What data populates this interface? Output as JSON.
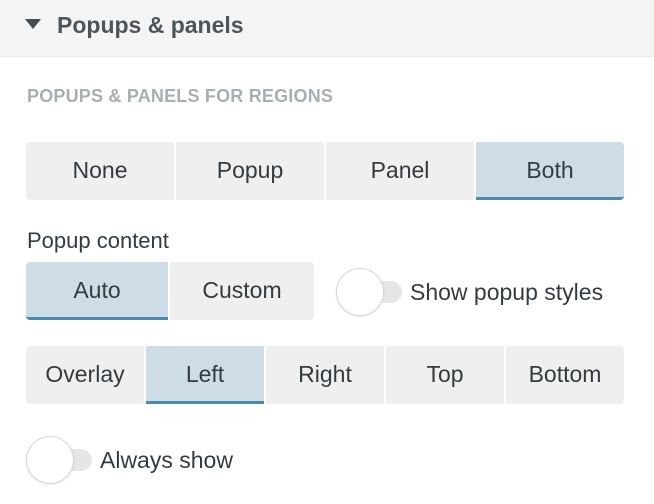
{
  "section": {
    "title": "Popups & panels",
    "expanded": true
  },
  "regions": {
    "heading": "POPUPS & PANELS FOR REGIONS",
    "mode_options": [
      "None",
      "Popup",
      "Panel",
      "Both"
    ],
    "mode_selected": "Both"
  },
  "popup_content": {
    "label": "Popup content",
    "options": [
      "Auto",
      "Custom"
    ],
    "selected": "Auto",
    "show_styles_label": "Show popup styles",
    "show_styles_on": false
  },
  "position": {
    "options": [
      "Overlay",
      "Left",
      "Right",
      "Top",
      "Bottom"
    ],
    "selected": "Left"
  },
  "always_show": {
    "label": "Always show",
    "on": false
  },
  "colors": {
    "active_bg": "#cedde5",
    "active_underline": "#4a8aac",
    "inactive_bg": "#efefef",
    "heading_gray": "#a9aeb1"
  }
}
